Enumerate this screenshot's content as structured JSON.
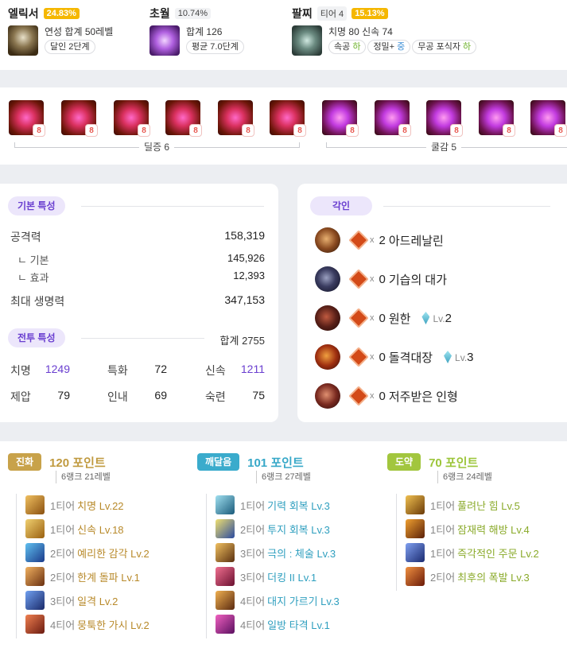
{
  "accessories": {
    "elixir": {
      "title": "엘릭서",
      "pct": "24.83%",
      "line1": "연성 합계 50레벨",
      "pill": "달인 2단계"
    },
    "transcend": {
      "title": "초월",
      "pct": "10.74%",
      "line1": "합계 126",
      "pill": "평균 7.0단계"
    },
    "bracelet": {
      "title": "팔찌",
      "tier": "티어 4",
      "pct": "15.13%",
      "line1": "치명 80  신속 74",
      "pills": [
        {
          "label": "속공",
          "grade": "하",
          "color": "green"
        },
        {
          "label": "정밀+",
          "grade": "중",
          "color": "blue"
        },
        {
          "label": "무공 포식자",
          "grade": "하",
          "color": "green"
        }
      ]
    }
  },
  "gems": {
    "levels": [
      "8",
      "8",
      "8",
      "8",
      "8",
      "8",
      "8",
      "8",
      "8",
      "8",
      "8"
    ],
    "damage_label": "딜증 6",
    "cooldown_label": "쿨감 5"
  },
  "stats": {
    "basic_title": "기본 특성",
    "attack_label": "공격력",
    "attack_value": "158,319",
    "base_label": "ㄴ 기본",
    "base_value": "145,926",
    "effect_label": "ㄴ 효과",
    "effect_value": "12,393",
    "hp_label": "최대 생명력",
    "hp_value": "347,153",
    "combat_title": "전투 특성",
    "combat_total": "합계 2755",
    "combat": [
      {
        "label": "치명",
        "value": "1249",
        "hl": true
      },
      {
        "label": "특화",
        "value": "72",
        "hl": false
      },
      {
        "label": "신속",
        "value": "1211",
        "hl": true
      },
      {
        "label": "제압",
        "value": "79",
        "hl": false
      },
      {
        "label": "인내",
        "value": "69",
        "hl": false
      },
      {
        "label": "숙련",
        "value": "75",
        "hl": false
      }
    ]
  },
  "engravings": {
    "title": "각인",
    "x": "x",
    "items": [
      {
        "count": "2",
        "name": "아드레날린",
        "stone": null
      },
      {
        "count": "0",
        "name": "기습의 대가",
        "stone": null
      },
      {
        "count": "0",
        "name": "원한",
        "stone": "2"
      },
      {
        "count": "0",
        "name": "돌격대장",
        "stone": "3"
      },
      {
        "count": "0",
        "name": "저주받은 인형",
        "stone": null
      }
    ],
    "lv_prefix": "Lv."
  },
  "ark": {
    "evolution": {
      "tag": "진화",
      "points": "120 포인트",
      "rank": "6랭크 21레벨",
      "color": "#c09a3f",
      "items": [
        {
          "tier": "1티어",
          "name": "치명 Lv.22"
        },
        {
          "tier": "1티어",
          "name": "신속 Lv.18"
        },
        {
          "tier": "2티어",
          "name": "예리한 감각 Lv.2"
        },
        {
          "tier": "2티어",
          "name": "한계 돌파 Lv.1"
        },
        {
          "tier": "3티어",
          "name": "일격 Lv.2"
        },
        {
          "tier": "4티어",
          "name": "뭉툭한 가시 Lv.2"
        }
      ]
    },
    "enlightenment": {
      "tag": "깨달음",
      "points": "101 포인트",
      "rank": "6랭크 27레벨",
      "color": "#37a8c8",
      "items": [
        {
          "tier": "1티어",
          "name": "기력 회복 Lv.3"
        },
        {
          "tier": "2티어",
          "name": "투지 회복 Lv.3"
        },
        {
          "tier": "3티어",
          "name": "극의 : 체술 Lv.3"
        },
        {
          "tier": "3티어",
          "name": "더킹 II Lv.1"
        },
        {
          "tier": "4티어",
          "name": "대지 가르기 Lv.3"
        },
        {
          "tier": "4티어",
          "name": "일방 타격 Lv.1"
        }
      ]
    },
    "leap": {
      "tag": "도약",
      "points": "70 포인트",
      "rank": "6랭크 24레벨",
      "color": "#9cc53a",
      "items": [
        {
          "tier": "1티어",
          "name": "풀려난 힘 Lv.5"
        },
        {
          "tier": "1티어",
          "name": "잠재력 해방 Lv.4"
        },
        {
          "tier": "1티어",
          "name": "즉각적인 주문 Lv.2"
        },
        {
          "tier": "2티어",
          "name": "최후의 폭발 Lv.3"
        }
      ]
    }
  }
}
